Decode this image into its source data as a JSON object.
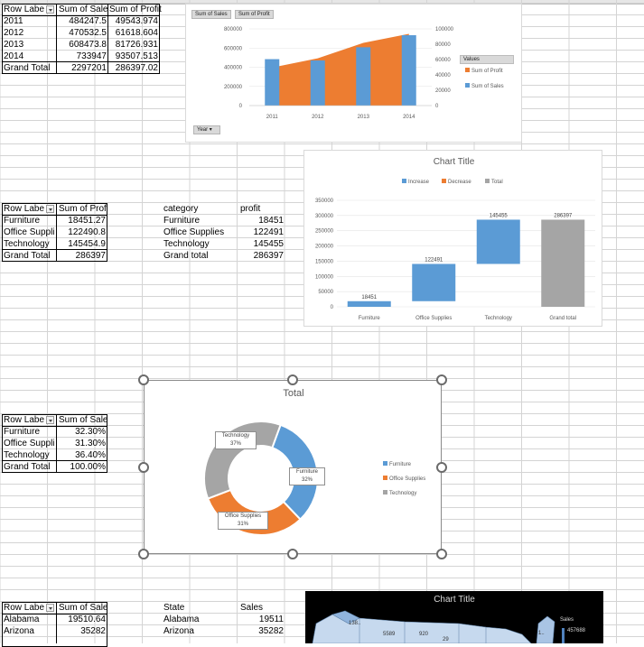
{
  "pivot1": {
    "headers": [
      "Row Labe",
      "Sum of Sale",
      "Sum of Profit"
    ],
    "rows": [
      [
        "2011",
        "484247.5",
        "49543.974"
      ],
      [
        "2012",
        "470532.5",
        "61618.604"
      ],
      [
        "2013",
        "608473.8",
        "81726.931"
      ],
      [
        "2014",
        "733947",
        "93507.513"
      ],
      [
        "Grand Total",
        "2297201",
        "286397.02"
      ]
    ]
  },
  "chart1": {
    "tab_sales": "Sum of Sales",
    "tab_profit": "Sum of Profit",
    "year_button": "Year",
    "legend_title": "Values",
    "legend_profit": "Sum of Profit",
    "legend_sales": "Sum of Sales",
    "colors": {
      "sales": "#5b9bd5",
      "profit": "#ed7d31"
    }
  },
  "chart_data": [
    {
      "type": "bar",
      "categories": [
        "2011",
        "2012",
        "2013",
        "2014"
      ],
      "series": [
        {
          "name": "Sum of Sales",
          "chart": "bar",
          "axis": "left",
          "values": [
            484247.5,
            470532.5,
            608473.8,
            733947
          ]
        },
        {
          "name": "Sum of Profit",
          "chart": "area",
          "axis": "right",
          "values": [
            49543.974,
            61618.604,
            81726.931,
            93507.513
          ]
        }
      ],
      "left_ticks": [
        "0",
        "200000",
        "400000",
        "600000",
        "800000"
      ],
      "right_ticks": [
        "0",
        "20000",
        "40000",
        "60000",
        "80000",
        "100000"
      ],
      "ylim_left": [
        0,
        800000
      ],
      "ylim_right": [
        0,
        100000
      ],
      "legend": "right"
    },
    {
      "type": "bar",
      "title": "Chart Title",
      "legend_items": [
        "Increase",
        "Decrease",
        "Total"
      ],
      "legend_colors": [
        "#5b9bd5",
        "#ed7d31",
        "#a5a5a5"
      ],
      "categories": [
        "Furniture",
        "Office Supplies",
        "Technology",
        "Grand total"
      ],
      "waterfall": [
        {
          "start": 0,
          "value": 18451,
          "label": "18451",
          "kind": "increase"
        },
        {
          "start": 18451,
          "value": 122491,
          "label": "122491",
          "kind": "increase"
        },
        {
          "start": 140942,
          "value": 145455,
          "label": "145455",
          "kind": "increase"
        },
        {
          "start": 0,
          "value": 286397,
          "label": "286397",
          "kind": "total"
        }
      ],
      "y_ticks": [
        "0",
        "50000",
        "100000",
        "150000",
        "200000",
        "250000",
        "300000",
        "350000"
      ],
      "ylim": [
        0,
        350000
      ],
      "legend": "top"
    },
    {
      "type": "pie",
      "title": "Total",
      "slices": [
        {
          "label": "Furniture",
          "pct": "32%",
          "value": 32.3,
          "color": "#5b9bd5"
        },
        {
          "label": "Office Supplies",
          "pct": "31%",
          "value": 31.3,
          "color": "#ed7d31"
        },
        {
          "label": "Technology",
          "pct": "37%",
          "value": 36.4,
          "color": "#a5a5a5"
        }
      ],
      "legend": "right"
    }
  ],
  "pivot2": {
    "headers": [
      "Row Labe",
      "Sum of Profit"
    ],
    "rows": [
      [
        "Furniture",
        "18451.27"
      ],
      [
        "Office Suppli",
        "122490.8"
      ],
      [
        "Technology",
        "145454.9"
      ],
      [
        "Grand Total",
        "286397"
      ]
    ]
  },
  "table2": {
    "headers": [
      "category",
      "profit"
    ],
    "rows": [
      [
        "Furniture",
        "18451"
      ],
      [
        "Office Supplies",
        "122491"
      ],
      [
        "Technology",
        "145455"
      ],
      [
        "Grand total",
        "286397"
      ]
    ]
  },
  "pivot3": {
    "headers": [
      "Row Labe",
      "Sum of Sales"
    ],
    "rows": [
      [
        "Furniture",
        "32.30%"
      ],
      [
        "Office Suppli",
        "31.30%"
      ],
      [
        "Technology",
        "36.40%"
      ],
      [
        "Grand Total",
        "100.00%"
      ]
    ]
  },
  "pivot4": {
    "headers": [
      "Row Labe",
      "Sum of Sales"
    ],
    "rows": [
      [
        "Alabama",
        "19510.64"
      ],
      [
        "Arizona",
        "35282"
      ]
    ]
  },
  "table4": {
    "headers": [
      "State",
      "Sales"
    ],
    "rows": [
      [
        "Alabama",
        "19511"
      ],
      [
        "Arizona",
        "35282"
      ]
    ]
  },
  "mapchart": {
    "title": "Chart Title",
    "legend_title": "Sales",
    "legend_value": "457688",
    "labels": [
      "138..",
      "5589",
      "920",
      "29",
      "1.."
    ]
  }
}
